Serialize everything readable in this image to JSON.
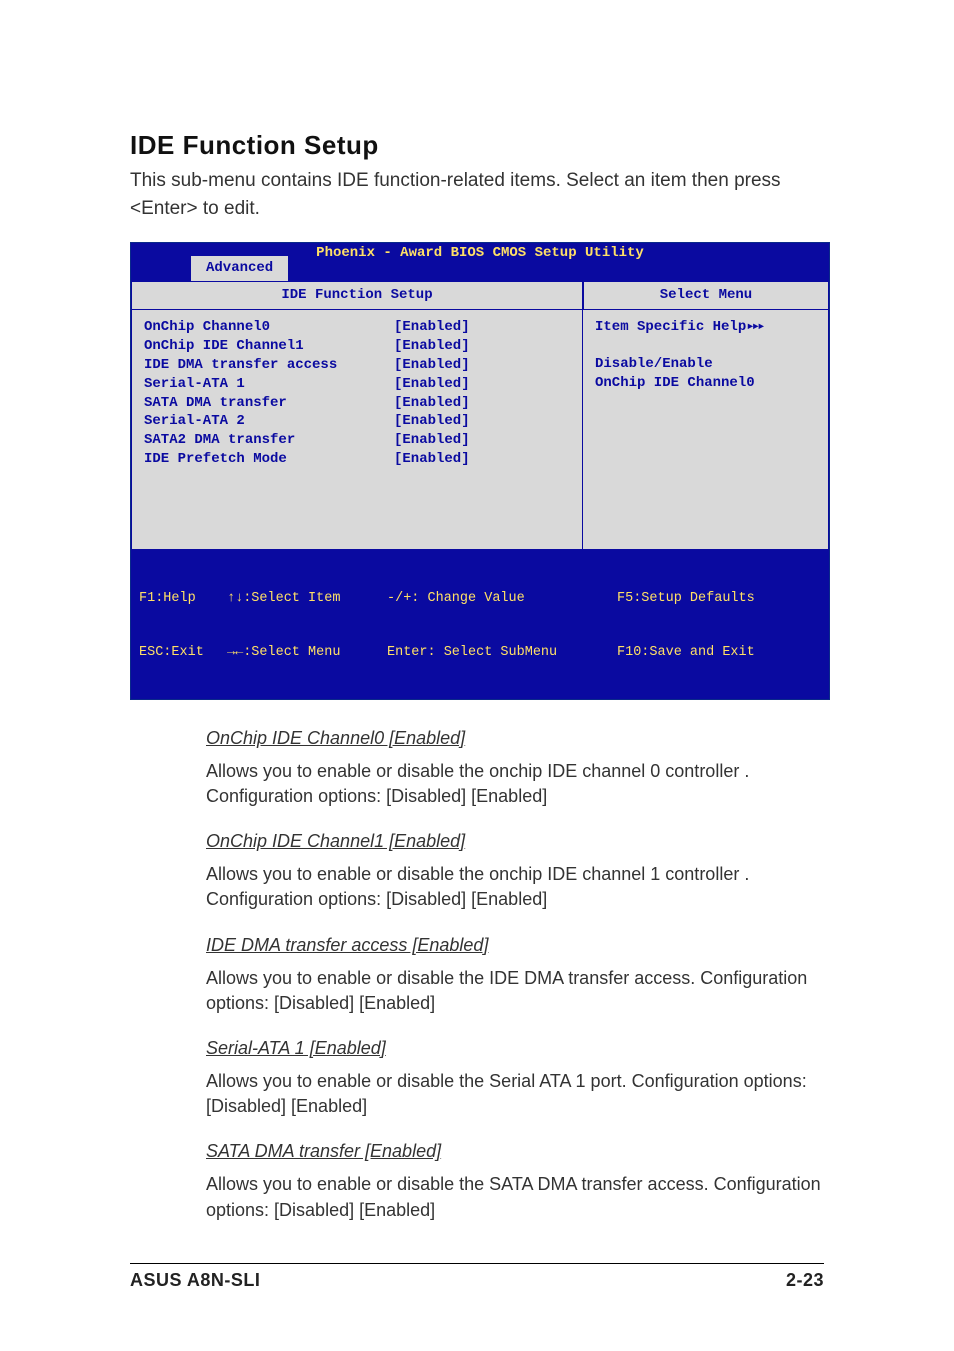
{
  "header": {
    "title": "IDE Function Setup",
    "intro": "This sub-menu contains IDE function-related items. Select an item then press <Enter> to edit."
  },
  "bios": {
    "top_title": "Phoenix - Award BIOS CMOS Setup Utility",
    "tab": "Advanced",
    "left_header": "IDE Function Setup",
    "right_header": "Select Menu",
    "items": [
      {
        "label": "OnChip Channel0",
        "value": "[Enabled]"
      },
      {
        "label": "OnChip IDE Channel1",
        "value": "[Enabled]"
      },
      {
        "label": "IDE DMA transfer access",
        "value": "[Enabled]"
      },
      {
        "label": "Serial-ATA 1",
        "value": "[Enabled]"
      },
      {
        "label": "SATA DMA transfer",
        "value": "[Enabled]"
      },
      {
        "label": "Serial-ATA 2",
        "value": "[Enabled]"
      },
      {
        "label": "SATA2 DMA transfer",
        "value": "[Enabled]"
      },
      {
        "label": "IDE Prefetch Mode",
        "value": "[Enabled]"
      }
    ],
    "help": {
      "title": "Item Specific Help",
      "arrows": "▸▸▸",
      "line1": "Disable/Enable",
      "line2": "OnChip IDE Channel0"
    },
    "footer": {
      "a1": "F1:Help",
      "a2": "ESC:Exit",
      "b1": "↑↓:Select Item",
      "b2": "→←:Select Menu",
      "c1": "-/+: Change Value",
      "c2": "Enter: Select SubMenu",
      "d1": "F5:Setup Defaults",
      "d2": "F10:Save and Exit"
    }
  },
  "descs": [
    {
      "h": "OnChip IDE Channel0 [Enabled]",
      "p": "Allows you to enable or disable the onchip IDE channel 0 controller . Configuration options: [Disabled] [Enabled]"
    },
    {
      "h": "OnChip IDE Channel1 [Enabled]",
      "p": "Allows you to enable or disable the onchip IDE channel 1 controller . Configuration options: [Disabled] [Enabled]"
    },
    {
      "h": "IDE DMA transfer access [Enabled]",
      "p": "Allows you to enable or disable the IDE DMA transfer access. Configuration options: [Disabled] [Enabled]"
    },
    {
      "h": "Serial-ATA 1 [Enabled]",
      "p": "Allows you to enable or disable the Serial ATA 1 port. Configuration options: [Disabled] [Enabled]"
    },
    {
      "h": "SATA DMA transfer [Enabled]",
      "p": "Allows you to enable or disable the SATA DMA transfer access. Configuration options: [Disabled] [Enabled]"
    }
  ],
  "footer": {
    "left": "ASUS A8N-SLI",
    "right": "2-23"
  }
}
